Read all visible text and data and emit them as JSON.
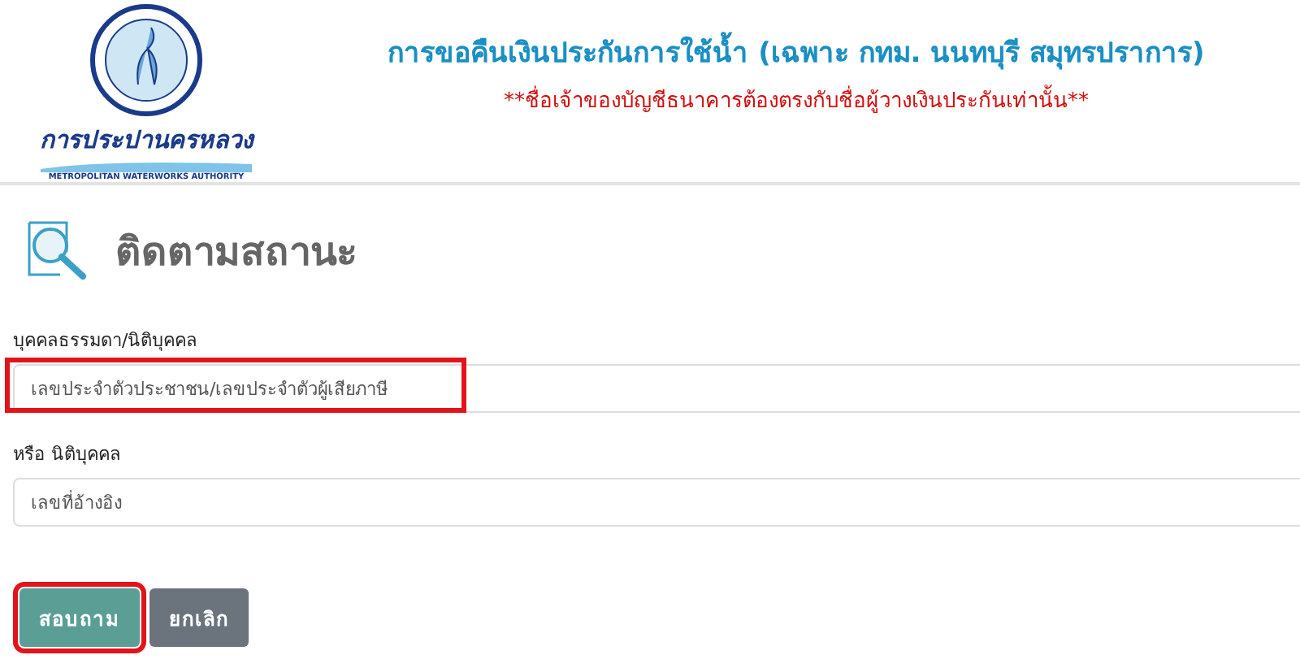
{
  "header": {
    "logo": {
      "name": "การประปานครหลวง",
      "subtitle": "METROPOLITAN WATERWORKS AUTHORITY"
    },
    "title": "การขอคืนเงินประกันการใช้น้ำ (เฉพาะ กทม. นนทบุรี สมุทรปราการ)",
    "notice": "**ชื่อเจ้าของบัญชีธนาคารต้องตรงกับชื่อผู้วางเงินประกันเท่านั้น**"
  },
  "section": {
    "title": "ติดตามสถานะ"
  },
  "fields": [
    {
      "label": "บุคคลธรรมดา/นิติบุคคล",
      "placeholder": "เลขประจำตัวประชาชน/เลขประจำตัวผู้เสียภาษี",
      "highlighted": true
    },
    {
      "label": "หรือ นิติบุคคล",
      "placeholder": "เลขที่อ้างอิง",
      "highlighted": false
    }
  ],
  "buttons": [
    {
      "label": "สอบถาม",
      "kind": "primary",
      "highlighted": true
    },
    {
      "label": "ยกเลิก",
      "kind": "secondary",
      "highlighted": false
    }
  ]
}
